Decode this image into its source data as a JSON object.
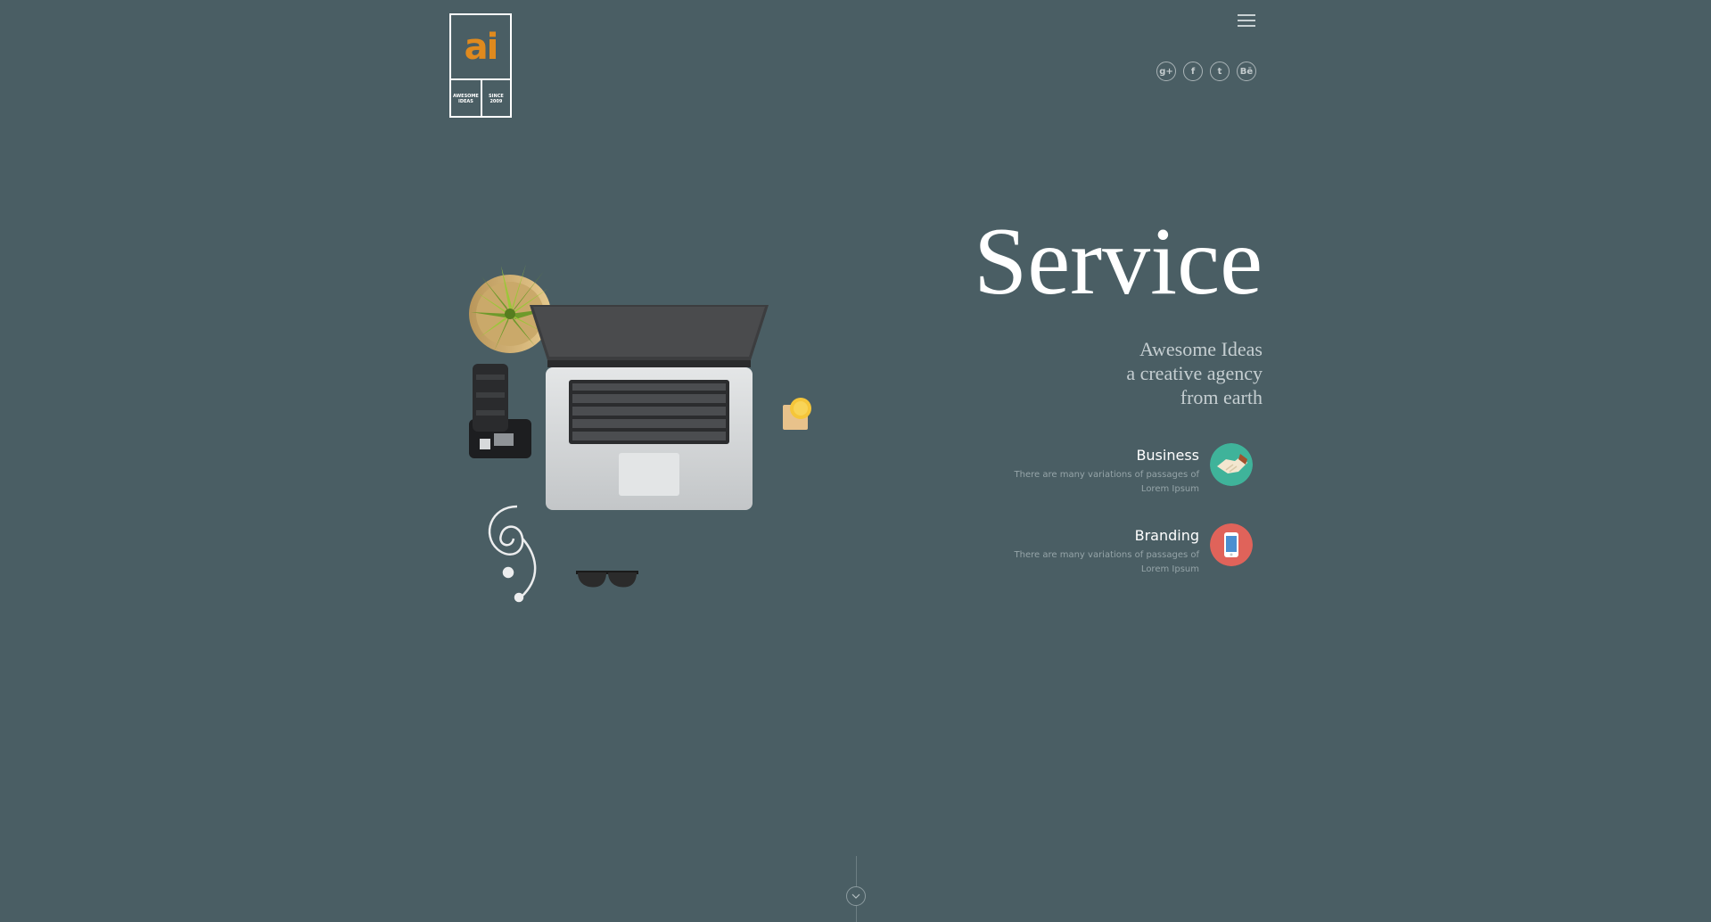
{
  "logo": {
    "letters": "ai",
    "left_text": "AWESOME\nIDEAS",
    "right_text": "SINCE\n2009"
  },
  "social": {
    "items": [
      {
        "name": "google-plus",
        "glyph": "g+"
      },
      {
        "name": "facebook",
        "glyph": "f"
      },
      {
        "name": "twitter",
        "glyph": "t"
      },
      {
        "name": "behance",
        "glyph": "Bē"
      }
    ]
  },
  "hero": {
    "title": "Service",
    "subtitle_line1": "Awesome Ideas",
    "subtitle_line2": "a creative agency",
    "subtitle_line3": "from earth"
  },
  "services": [
    {
      "title": "Business",
      "description": "There are many variations of passages of Lorem Ipsum",
      "icon": "handshake-icon",
      "color": "#3fb39a"
    },
    {
      "title": "Branding",
      "description": "There are many variations of passages of Lorem Ipsum",
      "icon": "smartphone-icon",
      "color": "#e0635a"
    }
  ],
  "colors": {
    "background": "#4a5e64",
    "accent": "#e08a1e"
  }
}
